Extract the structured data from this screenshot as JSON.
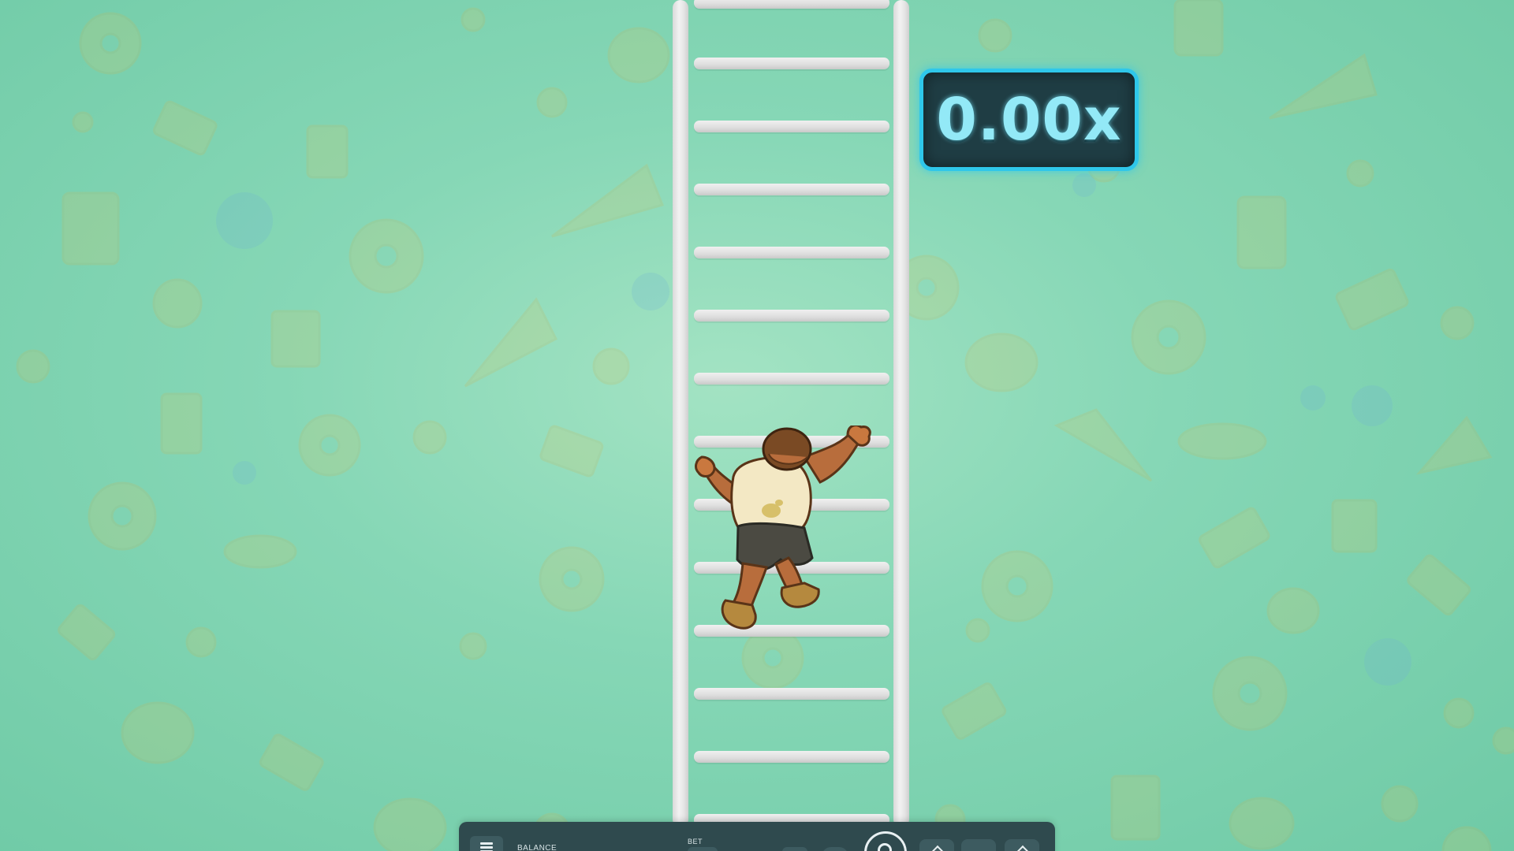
{
  "game": {
    "multiplier": "0.00x"
  },
  "control_bar": {
    "balance_label": "BALANCE",
    "bet_label": "BET"
  },
  "icons": {
    "menu": "menu-icon",
    "play": "play-icon"
  },
  "colors": {
    "background": "#86d7b6",
    "multiplier_border": "#2fc7ea",
    "multiplier_text": "#93e9f7",
    "control_bar": "#2f4a4e"
  }
}
